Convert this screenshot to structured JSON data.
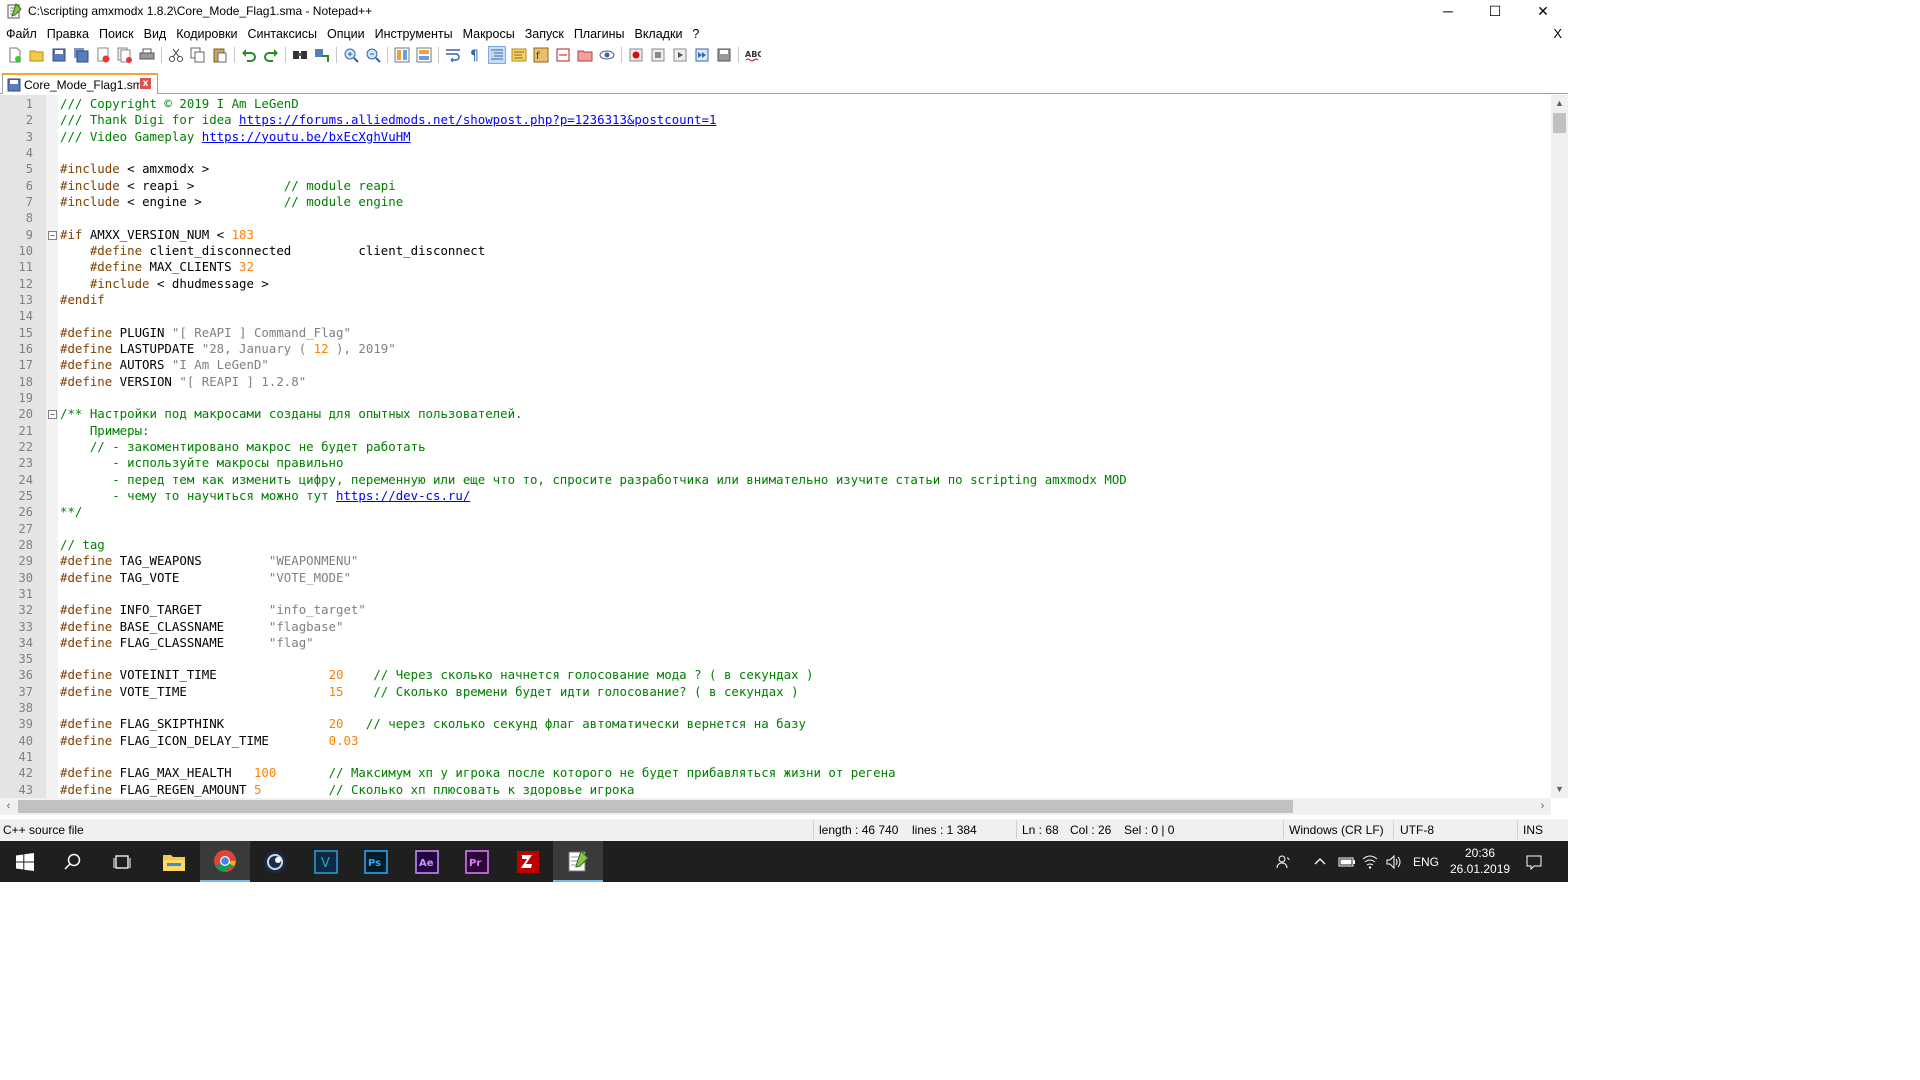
{
  "window": {
    "title": "C:\\scripting amxmodx 1.8.2\\Core_Mode_Flag1.sma - Notepad++",
    "controls": [
      "─",
      "☐",
      "✕"
    ]
  },
  "menu": {
    "items": [
      "Файл",
      "Правка",
      "Поиск",
      "Вид",
      "Кодировки",
      "Синтаксисы",
      "Опции",
      "Инструменты",
      "Макросы",
      "Запуск",
      "Плагины",
      "Вкладки",
      "?"
    ],
    "close": "X"
  },
  "toolbar": {
    "icons": [
      "new-file-icon",
      "open-file-icon",
      "save-icon",
      "save-all-icon",
      "close-icon",
      "close-all-icon",
      "print-icon",
      "cut-icon",
      "copy-icon",
      "paste-icon",
      "undo-icon",
      "redo-icon",
      "find-icon",
      "replace-icon",
      "zoom-in-icon",
      "zoom-out-icon",
      "sync-vertical-icon",
      "sync-horizontal-icon",
      "word-wrap-icon",
      "show-all-chars-icon",
      "indent-guide-icon",
      "document-map-icon",
      "function-list-icon",
      "folder-workspace-icon",
      "monitoring-icon",
      "record-macro-icon",
      "stop-macro-icon",
      "play-macro-icon",
      "run-macro-multiple-icon",
      "save-macro-icon",
      "spell-check-icon"
    ]
  },
  "tab": {
    "label": "Core_Mode_Flag1.sma",
    "close": "x"
  },
  "code_lines": [
    "/// Copyright © 2019 I Am LeGenD",
    "/// Thank Digi for idea https://forums.alliedmods.net/showpost.php?p=1236313&postcount=1",
    "/// Video Gameplay https://youtu.be/bxEcXghVuHM",
    "",
    "#include < amxmodx >",
    "#include < reapi >            // module reapi",
    "#include < engine >           // module engine",
    "",
    "#if AMXX_VERSION_NUM < 183",
    "    #define client_disconnected         client_disconnect",
    "    #define MAX_CLIENTS 32",
    "    #include < dhudmessage >",
    "#endif",
    "",
    "#define PLUGIN \"[ ReAPI ] Command_Flag\"",
    "#define LASTUPDATE \"28, January ( 12 ), 2019\"",
    "#define AUTORS \"I Am LeGenD\"",
    "#define VERSION \"[ REAPI ] 1.2.8\"",
    "",
    "/** Настройки под макросами созданы для опытных пользователей.",
    "    Примеры:",
    "    // - закоментировано макрос не будет работать",
    "       - используйте макросы правильно",
    "       - перед тем как изменить цифру, переменную или еще что то, спросите разработчика или внимательно изучите статьи по scripting amxmodx MOD",
    "       - чему то научиться можно тут https://dev-cs.ru/",
    "**/",
    "",
    "// tag",
    "#define TAG_WEAPONS         \"WEAPONMENU\"",
    "#define TAG_VOTE            \"VOTE_MODE\"",
    "",
    "#define INFO_TARGET         \"info_target\"",
    "#define BASE_CLASSNAME      \"flagbase\"",
    "#define FLAG_CLASSNAME      \"flag\"",
    "",
    "#define VOTEINIT_TIME               20    // Через сколько начнется голосование мода ? ( в секундах )",
    "#define VOTE_TIME                   15    // Сколько времени будет идти голосование? ( в секундах )",
    "",
    "#define FLAG_SKIPTHINK              20   // через сколько секунд флаг автоматически вернется на базу",
    "#define FLAG_ICON_DELAY_TIME        0.03",
    "",
    "#define FLAG_MAX_HEALTH   100       // Максимум хп у игрока после которого не будет прибавляться жизни от регена",
    "#define FLAG_REGEN_AMOUNT 5         // Сколько хп плюсовать к здоровье игрока"
  ],
  "status": {
    "filetype": "C++ source file",
    "length": "length : 46 740",
    "lines": "lines : 1 384",
    "ln": "Ln : 68",
    "col": "Col : 26",
    "sel": "Sel : 0 | 0",
    "eol": "Windows (CR LF)",
    "encoding": "UTF-8",
    "mode": "INS"
  },
  "taskbar": {
    "apps": [
      "start-icon",
      "search-icon",
      "task-view-icon",
      "file-explorer-icon",
      "chrome-icon",
      "cinema4d-icon",
      "vegas-icon",
      "photoshop-icon",
      "after-effects-icon",
      "premiere-icon",
      "filezilla-icon",
      "notepadpp-icon"
    ],
    "labels": {
      "vegas": "V",
      "photoshop": "Ps",
      "after_effects": "Ae",
      "premiere": "Pr"
    },
    "lang": "ENG",
    "time": "20:36",
    "date": "26.01.2019"
  }
}
